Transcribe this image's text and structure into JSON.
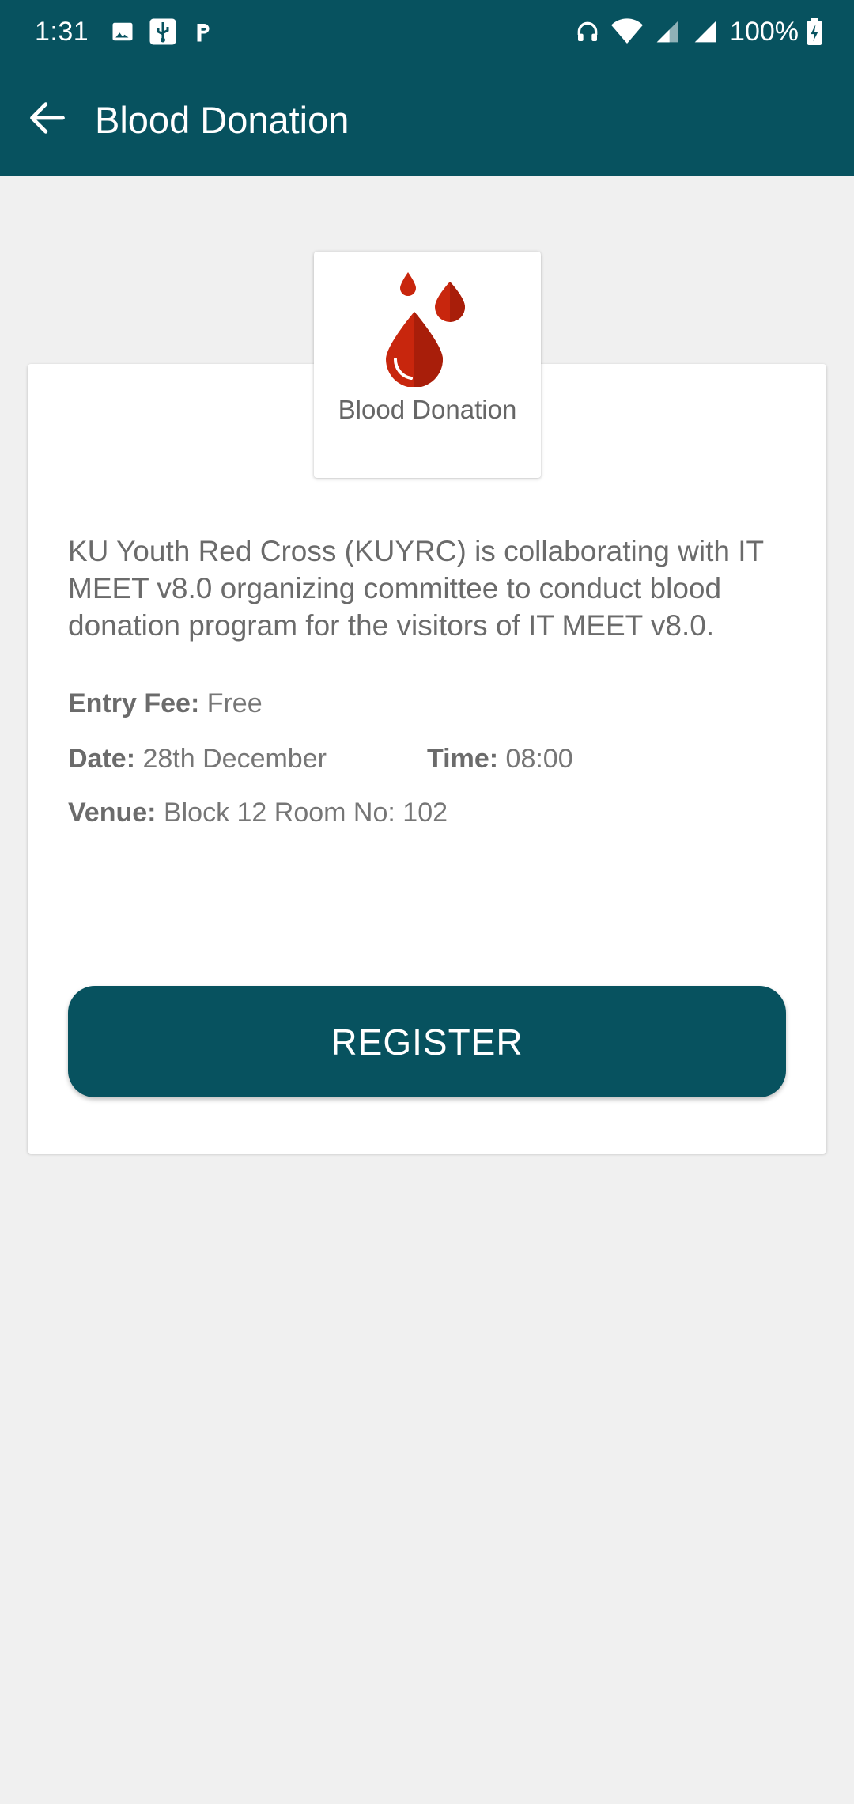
{
  "status_bar": {
    "time": "1:31",
    "battery": "100%",
    "icons": [
      "image-icon",
      "usb-icon",
      "p-icon",
      "headphones-icon",
      "wifi-icon",
      "signal-icon",
      "signal-icon",
      "battery-charging-icon"
    ]
  },
  "app_bar": {
    "title": "Blood Donation",
    "back_icon": "back-arrow-icon"
  },
  "event": {
    "logo_label": "Blood Donation",
    "logo_icon": "blood-drops-icon",
    "description": "KU Youth Red Cross (KUYRC) is collaborating with IT MEET v8.0 organizing committee to conduct blood donation program for the visitors of IT MEET v8.0.",
    "entry_fee_label": "Entry Fee:",
    "entry_fee": "Free",
    "date_label": "Date:",
    "date": "28th December",
    "time_label": "Time:",
    "time": "08:00",
    "venue_label": "Venue:",
    "venue": "Block 12 Room No: 102",
    "register_label": "REGISTER"
  },
  "colors": {
    "primary": "#07525f",
    "background": "#f0f0f0",
    "drop_red": "#c8260d"
  }
}
